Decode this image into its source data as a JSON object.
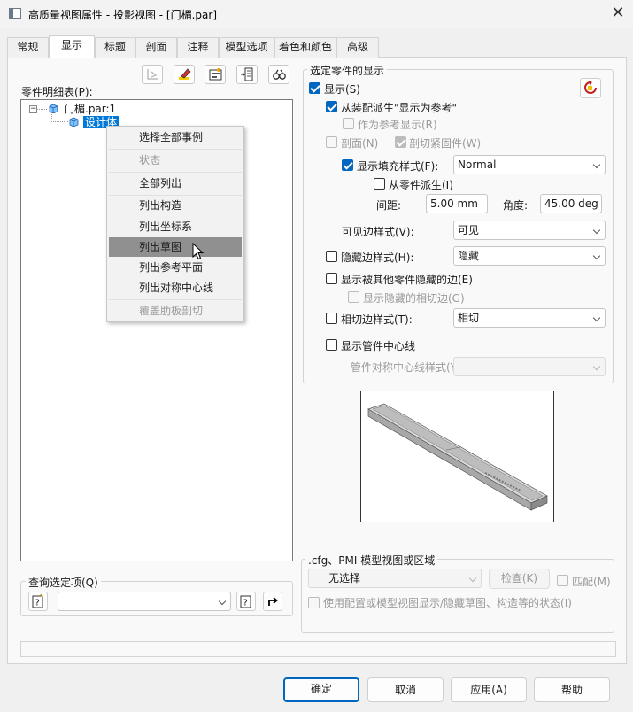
{
  "window": {
    "title": "高质量视图属性 - 投影视图 - [门楣.par]"
  },
  "tabs": [
    "常规",
    "显示",
    "标题",
    "剖面",
    "注释",
    "模型选项",
    "着色和颜色",
    "高级"
  ],
  "active_tab": 1,
  "parts_list": {
    "label": "零件明细表(P):",
    "root": "门楣.par:1",
    "child": "设计体"
  },
  "context_menu": {
    "items": [
      {
        "label": "选择全部事例",
        "enabled": true
      },
      {
        "label": "状态",
        "enabled": false
      },
      {
        "label": "全部列出",
        "enabled": true
      },
      {
        "label": "列出构造",
        "enabled": true
      },
      {
        "label": "列出坐标系",
        "enabled": true
      },
      {
        "label": "列出草图",
        "enabled": true,
        "highlighted": true
      },
      {
        "label": "列出参考平面",
        "enabled": true
      },
      {
        "label": "列出对称中心线",
        "enabled": true
      },
      {
        "label": "覆盖肋板剖切",
        "enabled": false
      }
    ]
  },
  "query": {
    "label": "查询选定项(Q)",
    "value": ""
  },
  "part_display": {
    "title": "选定零件的显示",
    "show": {
      "label": "显示(S)",
      "checked": true
    },
    "from_assembly": {
      "label": "从装配派生\"显示为参考\"",
      "checked": true
    },
    "as_reference": {
      "label": "作为参考显示(R)",
      "checked": false
    },
    "section": {
      "label": "剖面(N)",
      "checked": false
    },
    "cut_fasteners": {
      "label": "剖切紧固件(W)",
      "checked": true
    },
    "fill_style": {
      "label": "显示填充样式(F):",
      "checked": true,
      "value": "Normal"
    },
    "derive_from_part": {
      "label": "从零件派生(I)",
      "checked": false
    },
    "spacing": {
      "label": "间距:",
      "value": "5.00 mm"
    },
    "angle": {
      "label": "角度:",
      "value": "45.00 deg"
    },
    "visible_edge": {
      "label": "可见边样式(V):",
      "value": "可见"
    },
    "hidden_edge": {
      "label": "隐藏边样式(H):",
      "checked": false,
      "value": "隐藏"
    },
    "show_hidden_by_others": {
      "label": "显示被其他零件隐藏的边(E)",
      "checked": false
    },
    "show_hidden_tangent": {
      "label": "显示隐藏的相切边(G)",
      "checked": false
    },
    "tangent_edge": {
      "label": "相切边样式(T):",
      "checked": false,
      "value": "相切"
    },
    "pipe_centerline": {
      "label": "显示管件中心线",
      "checked": false
    },
    "pipe_symmetric_style": {
      "label": "管件对称中心线样式(Y):",
      "value": ""
    }
  },
  "cfg_group": {
    "title": ".cfg、PMI 模型视图或区域",
    "dropdown": "无选择",
    "check_button": "检查(K)",
    "match": {
      "label": "匹配(M)",
      "checked": false
    },
    "use_config": {
      "label": "使用配置或模型视图显示/隐藏草图、构造等的状态(I)",
      "checked": false
    }
  },
  "buttons": {
    "ok": "确定",
    "cancel": "取消",
    "apply": "应用(A)",
    "help": "帮助"
  },
  "icons": {
    "close": "close-icon",
    "tree_part": "part-cube-icon",
    "query_help": "query-help-icon"
  },
  "colors": {
    "accent": "#0067c0",
    "selection": "#0078d7",
    "menu_highlight": "#909090"
  }
}
